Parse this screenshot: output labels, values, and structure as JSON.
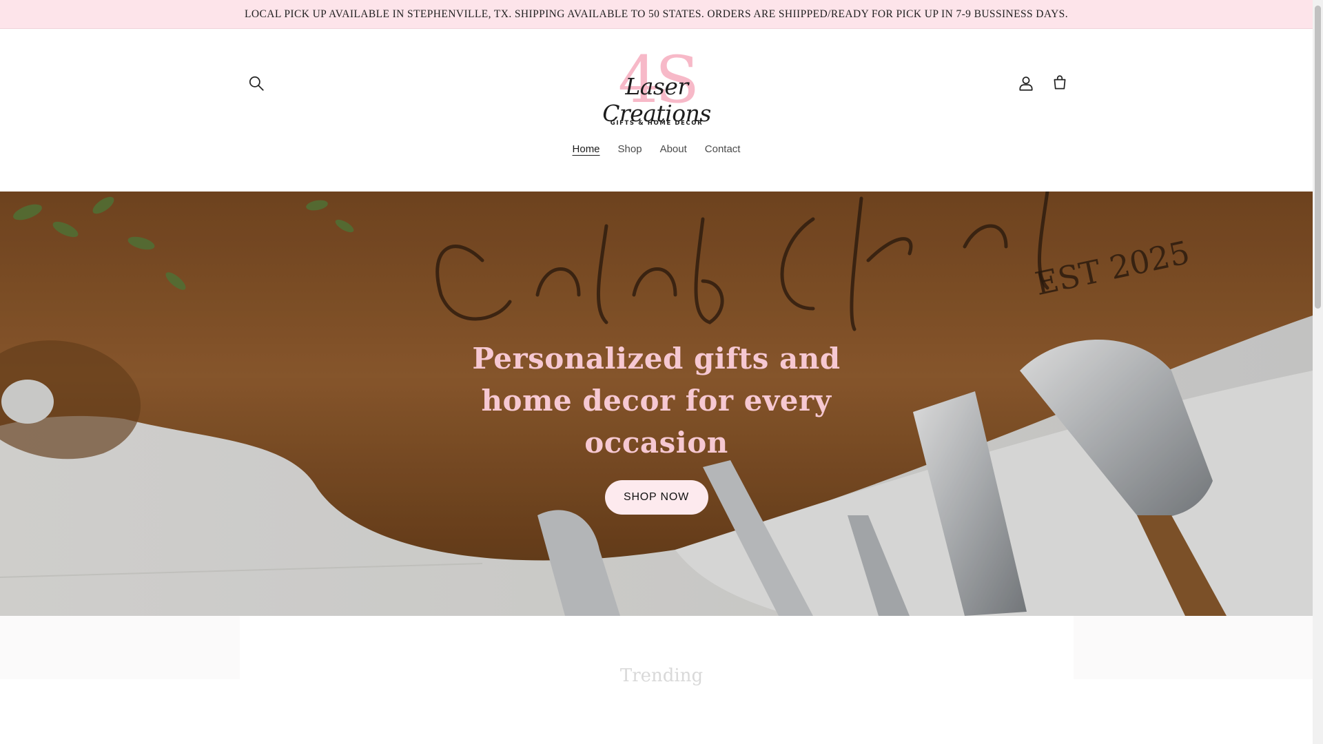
{
  "announcement": {
    "text": "LOCAL PICK UP AVAILABLE IN STEPHENVILLE, TX. SHIPPING AVAILABLE TO 50 STATES. ORDERS ARE SHIIPPED/READY FOR PICK UP IN 7-9 BUSSINESS DAYS."
  },
  "header": {
    "logo": {
      "initials": "4S",
      "script": "Laser Creations",
      "tagline": "GIFTS & HOME DECOR"
    },
    "icons": {
      "search": "search-icon",
      "account": "account-icon",
      "cart": "cart-icon"
    },
    "nav": [
      {
        "label": "Home",
        "active": true
      },
      {
        "label": "Shop",
        "active": false
      },
      {
        "label": "About",
        "active": false
      },
      {
        "label": "Contact",
        "active": false
      }
    ]
  },
  "hero": {
    "heading": "Personalized gifts and home decor for every occasion",
    "button_label": "SHOP NOW",
    "image_text": {
      "names": "Caleb & Kristina",
      "est": "EST 2025"
    }
  },
  "trending": {
    "title": "Trending"
  },
  "colors": {
    "announcement_bg": "#fde4ea",
    "brand_pink": "#f7b9c8",
    "hero_heading": "#f6c8d2",
    "button_bg": "#fdeaee"
  }
}
